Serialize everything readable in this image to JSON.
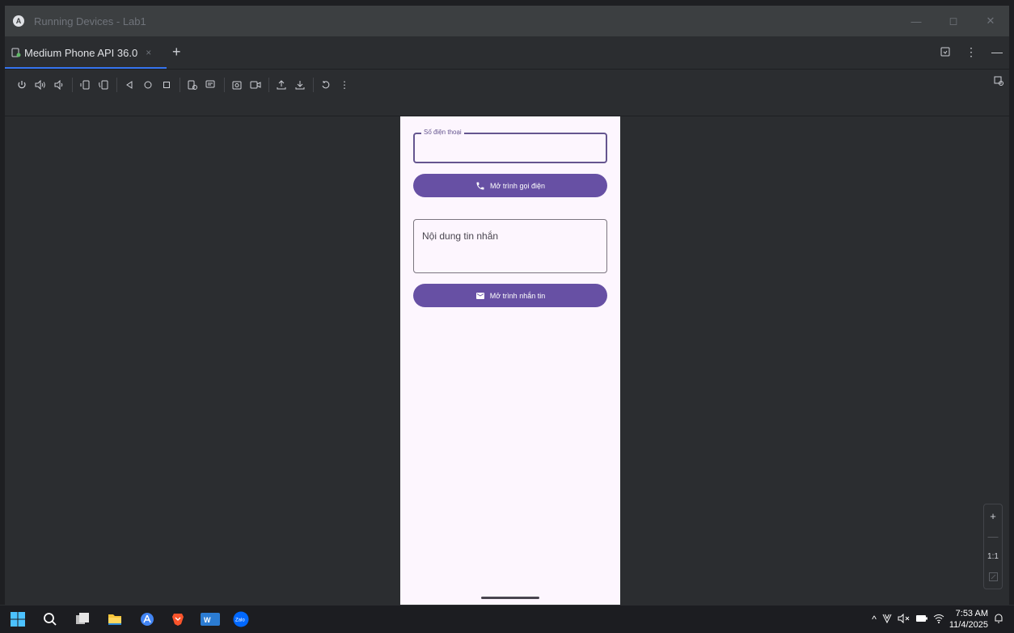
{
  "window": {
    "title": "Running Devices - Lab1",
    "minimize_label": "—",
    "restore_label": "◻",
    "close_label": "✕"
  },
  "tabs": {
    "device_tab_label": "Medium Phone API 36.0",
    "close_label": "×",
    "add_label": "+"
  },
  "toolbar": {
    "icons": [
      "power-icon",
      "volume-up-icon",
      "volume-down-icon",
      "rotate-left-icon",
      "rotate-right-icon",
      "back-icon",
      "home-icon",
      "overview-icon",
      "device-info-icon",
      "snapshot-icon",
      "screenshot-icon",
      "screen-record-icon",
      "push-file-icon",
      "pull-file-icon",
      "reset-icon",
      "more-icon"
    ]
  },
  "phone": {
    "phone_label": "Số điện thoại",
    "call_button_label": "Mở trình gọi điện",
    "message_placeholder": "Nội dung tin nhắn",
    "sms_button_label": "Mở trình nhắn tin",
    "accent_color": "#6750a4"
  },
  "zoom": {
    "zoom_in_label": "+",
    "zoom_out_label": "—",
    "ratio_label": "1:1"
  },
  "taskbar": {
    "time": "7:53 AM",
    "date": "11/4/2025",
    "zalo_label": "Zalo",
    "word_label": "W"
  }
}
